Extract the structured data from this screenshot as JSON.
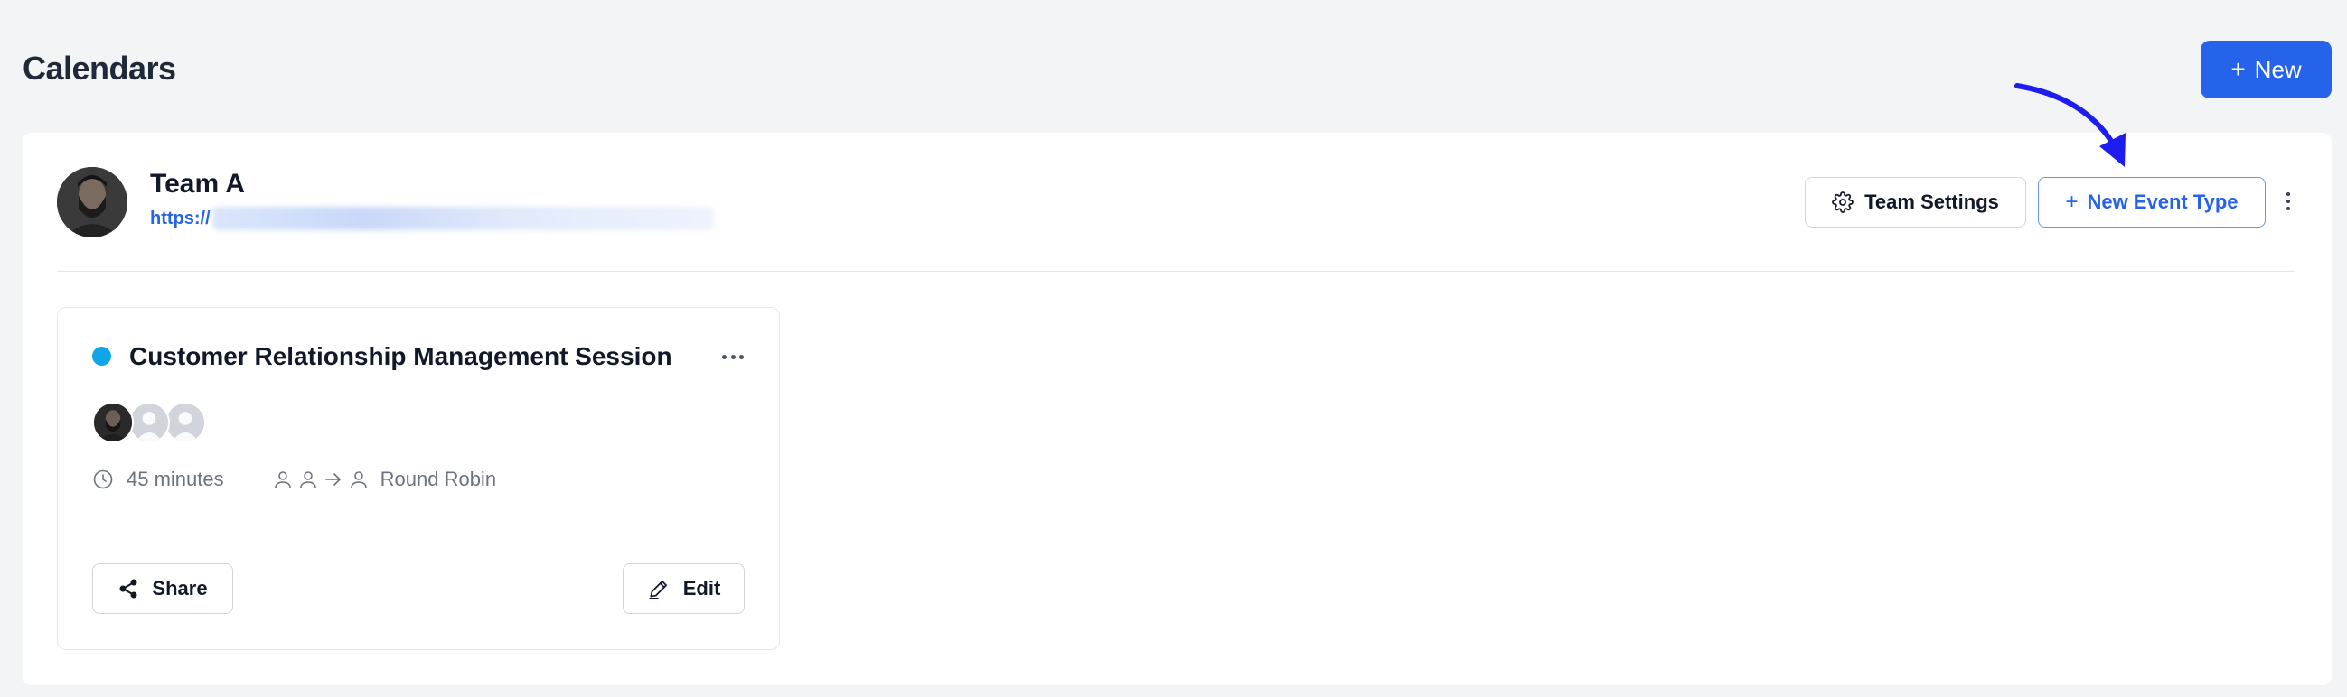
{
  "header": {
    "title": "Calendars",
    "new_button": {
      "icon": "plus-icon",
      "label": "New"
    }
  },
  "team": {
    "name": "Team A",
    "url_prefix": "https://",
    "settings_button": {
      "icon": "gear-icon",
      "label": "Team Settings"
    },
    "new_event_button": {
      "icon": "plus-icon",
      "label": "New Event Type"
    },
    "more_icon": "vertical-ellipsis-icon"
  },
  "event": {
    "status_color": "#0ea5e9",
    "title": "Customer Relationship Management Session",
    "more_icon": "horizontal-ellipsis-icon",
    "hosts": [
      "host-avatar-photo",
      "host-avatar-placeholder",
      "host-avatar-placeholder"
    ],
    "duration": {
      "icon": "clock-icon",
      "label": "45 minutes"
    },
    "assignment": {
      "icon": "round-robin-icon",
      "label": "Round Robin"
    },
    "share_button": {
      "icon": "share-icon",
      "label": "Share"
    },
    "edit_button": {
      "icon": "pencil-icon",
      "label": "Edit"
    }
  },
  "annotation": {
    "icon": "arrow-pointer-icon",
    "color": "#1d1df0"
  },
  "colors": {
    "primary": "#2563eb",
    "background": "#f3f4f6",
    "panel": "#ffffff",
    "border": "#d1d5db"
  }
}
